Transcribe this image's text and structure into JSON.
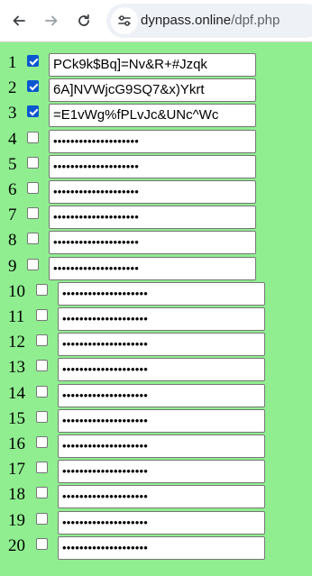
{
  "browser": {
    "url_host": "dynpass.online",
    "url_path": "/dpf.php",
    "back_icon": "arrow-left-icon",
    "forward_icon": "arrow-right-icon",
    "reload_icon": "reload-icon",
    "site_info_icon": "tune-icon"
  },
  "rows": [
    {
      "num": "1",
      "checked": true,
      "value": "PCk9k$Bq]=Nv&R+#Jzqk"
    },
    {
      "num": "2",
      "checked": true,
      "value": "6A]NVWjcG9SQ7&x)Ykrt"
    },
    {
      "num": "3",
      "checked": true,
      "value": "=E1vWg%fPLvJc&UNc^Wc"
    },
    {
      "num": "4",
      "checked": false,
      "value": "••••••••••••••••••••"
    },
    {
      "num": "5",
      "checked": false,
      "value": "••••••••••••••••••••"
    },
    {
      "num": "6",
      "checked": false,
      "value": "••••••••••••••••••••"
    },
    {
      "num": "7",
      "checked": false,
      "value": "••••••••••••••••••••"
    },
    {
      "num": "8",
      "checked": false,
      "value": "••••••••••••••••••••"
    },
    {
      "num": "9",
      "checked": false,
      "value": "••••••••••••••••••••"
    },
    {
      "num": "10",
      "checked": false,
      "value": "••••••••••••••••••••"
    },
    {
      "num": "11",
      "checked": false,
      "value": "••••••••••••••••••••"
    },
    {
      "num": "12",
      "checked": false,
      "value": "••••••••••••••••••••"
    },
    {
      "num": "13",
      "checked": false,
      "value": "••••••••••••••••••••"
    },
    {
      "num": "14",
      "checked": false,
      "value": "••••••••••••••••••••"
    },
    {
      "num": "15",
      "checked": false,
      "value": "••••••••••••••••••••"
    },
    {
      "num": "16",
      "checked": false,
      "value": "••••••••••••••••••••"
    },
    {
      "num": "17",
      "checked": false,
      "value": "••••••••••••••••••••"
    },
    {
      "num": "18",
      "checked": false,
      "value": "••••••••••••••••••••"
    },
    {
      "num": "19",
      "checked": false,
      "value": "••••••••••••••••••••"
    },
    {
      "num": "20",
      "checked": false,
      "value": "••••••••••••••••••••"
    }
  ]
}
